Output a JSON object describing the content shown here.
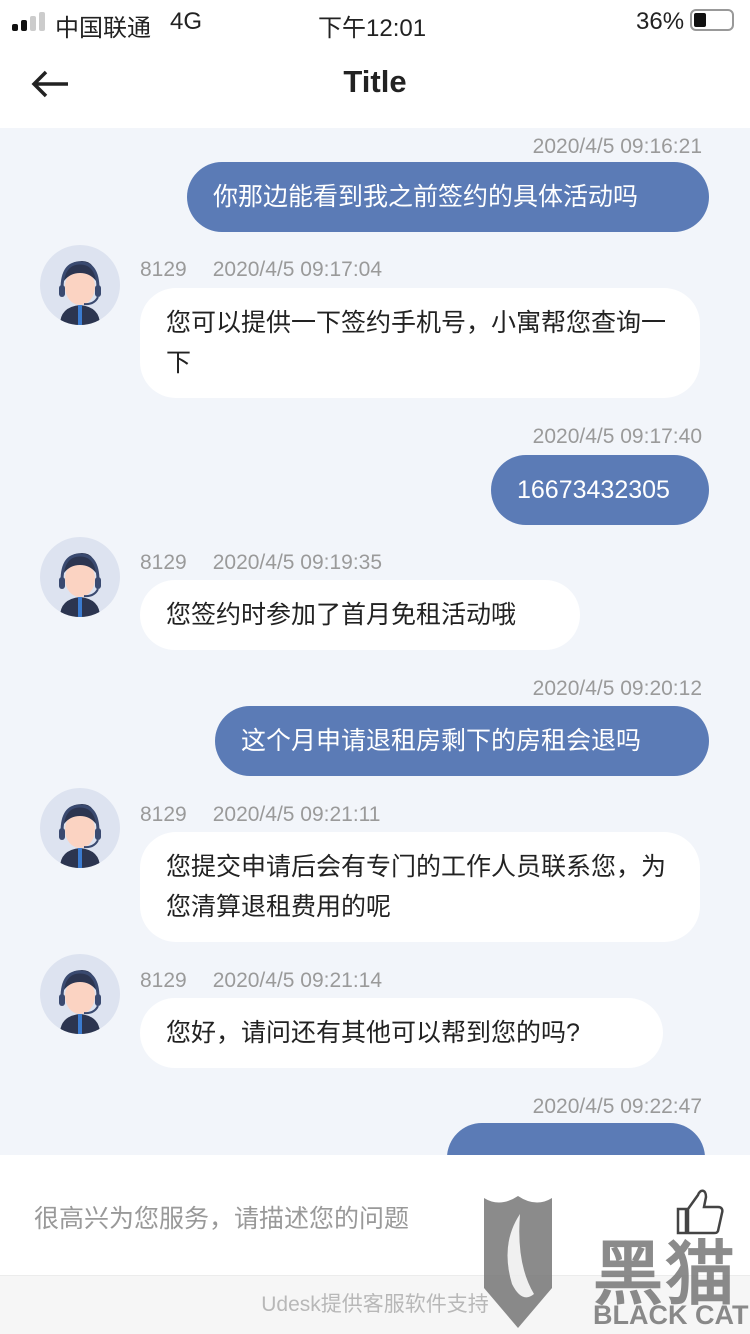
{
  "status_bar": {
    "carrier": "中国联通",
    "network": "4G",
    "time": "下午12:01",
    "battery": "36%"
  },
  "nav": {
    "title": "Title",
    "back_icon": "arrow-left-icon"
  },
  "messages": [
    {
      "side": "sent",
      "time": "2020/4/5 09:16:21",
      "text": "你那边能看到我之前签约的具体活动吗"
    },
    {
      "side": "recv",
      "agent": "8129",
      "time": "2020/4/5 09:17:04",
      "text": "您可以提供一下签约手机号，小寓帮您查询一下"
    },
    {
      "side": "sent",
      "time": "2020/4/5 09:17:40",
      "text": "16673432305"
    },
    {
      "side": "recv",
      "agent": "8129",
      "time": "2020/4/5 09:19:35",
      "text": "您签约时参加了首月免租活动哦"
    },
    {
      "side": "sent",
      "time": "2020/4/5 09:20:12",
      "text": "这个月申请退租房剩下的房租会退吗"
    },
    {
      "side": "recv",
      "agent": "8129",
      "time": "2020/4/5 09:21:11",
      "text": "您提交申请后会有专门的工作人员联系您，为您清算退租费用的呢"
    },
    {
      "side": "recv",
      "agent": "8129",
      "time": "2020/4/5 09:21:14",
      "text": "您好，请问还有其他可以帮到您的吗?"
    },
    {
      "side": "sent",
      "time": "2020/4/5 09:22:47",
      "text": ""
    }
  ],
  "input": {
    "placeholder": "很高兴为您服务，请描述您的问题",
    "rate_icon": "thumbs-up-icon"
  },
  "footer": {
    "text": "Udesk提供客服软件支持"
  },
  "watermark": {
    "text_cn": "黑猫",
    "text_en": "BLACK CAT"
  },
  "colors": {
    "sent_bubble": "#5b7bb6",
    "chat_bg": "#f2f5fa"
  }
}
